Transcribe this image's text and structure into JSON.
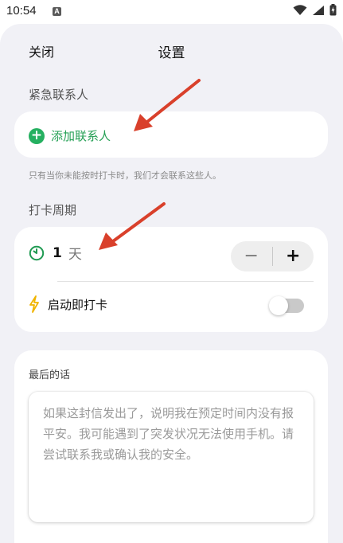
{
  "status_bar": {
    "time": "10:54",
    "notification_badge": "A"
  },
  "header": {
    "close_label": "关闭",
    "title": "设置"
  },
  "emergency": {
    "section_label": "紧急联系人",
    "add_contact_label": "添加联系人",
    "hint": "只有当你未能按时打卡时，我们才会联系这些人。"
  },
  "checkin": {
    "section_label": "打卡周期",
    "days_value": "1",
    "days_unit": "天",
    "minus_label": "−",
    "plus_label": "+",
    "instant_label": "启动即打卡",
    "instant_enabled": false
  },
  "last_words": {
    "label": "最后的话",
    "text": "如果这封信发出了，说明我在预定时间内没有报平安。我可能遇到了突发状况无法使用手机。请尝试联系我或确认我的安全。"
  },
  "colors": {
    "accent_green": "#25b060",
    "annotation_red": "#d9402b",
    "sheet_background": "#f1f1f6",
    "lightning_yellow": "#f0b400"
  },
  "icons": {
    "status": [
      "wifi-icon",
      "signal-icon",
      "battery-icon"
    ],
    "add": "plus-circle-icon",
    "period": "clock-icon",
    "instant": "lightning-icon"
  }
}
